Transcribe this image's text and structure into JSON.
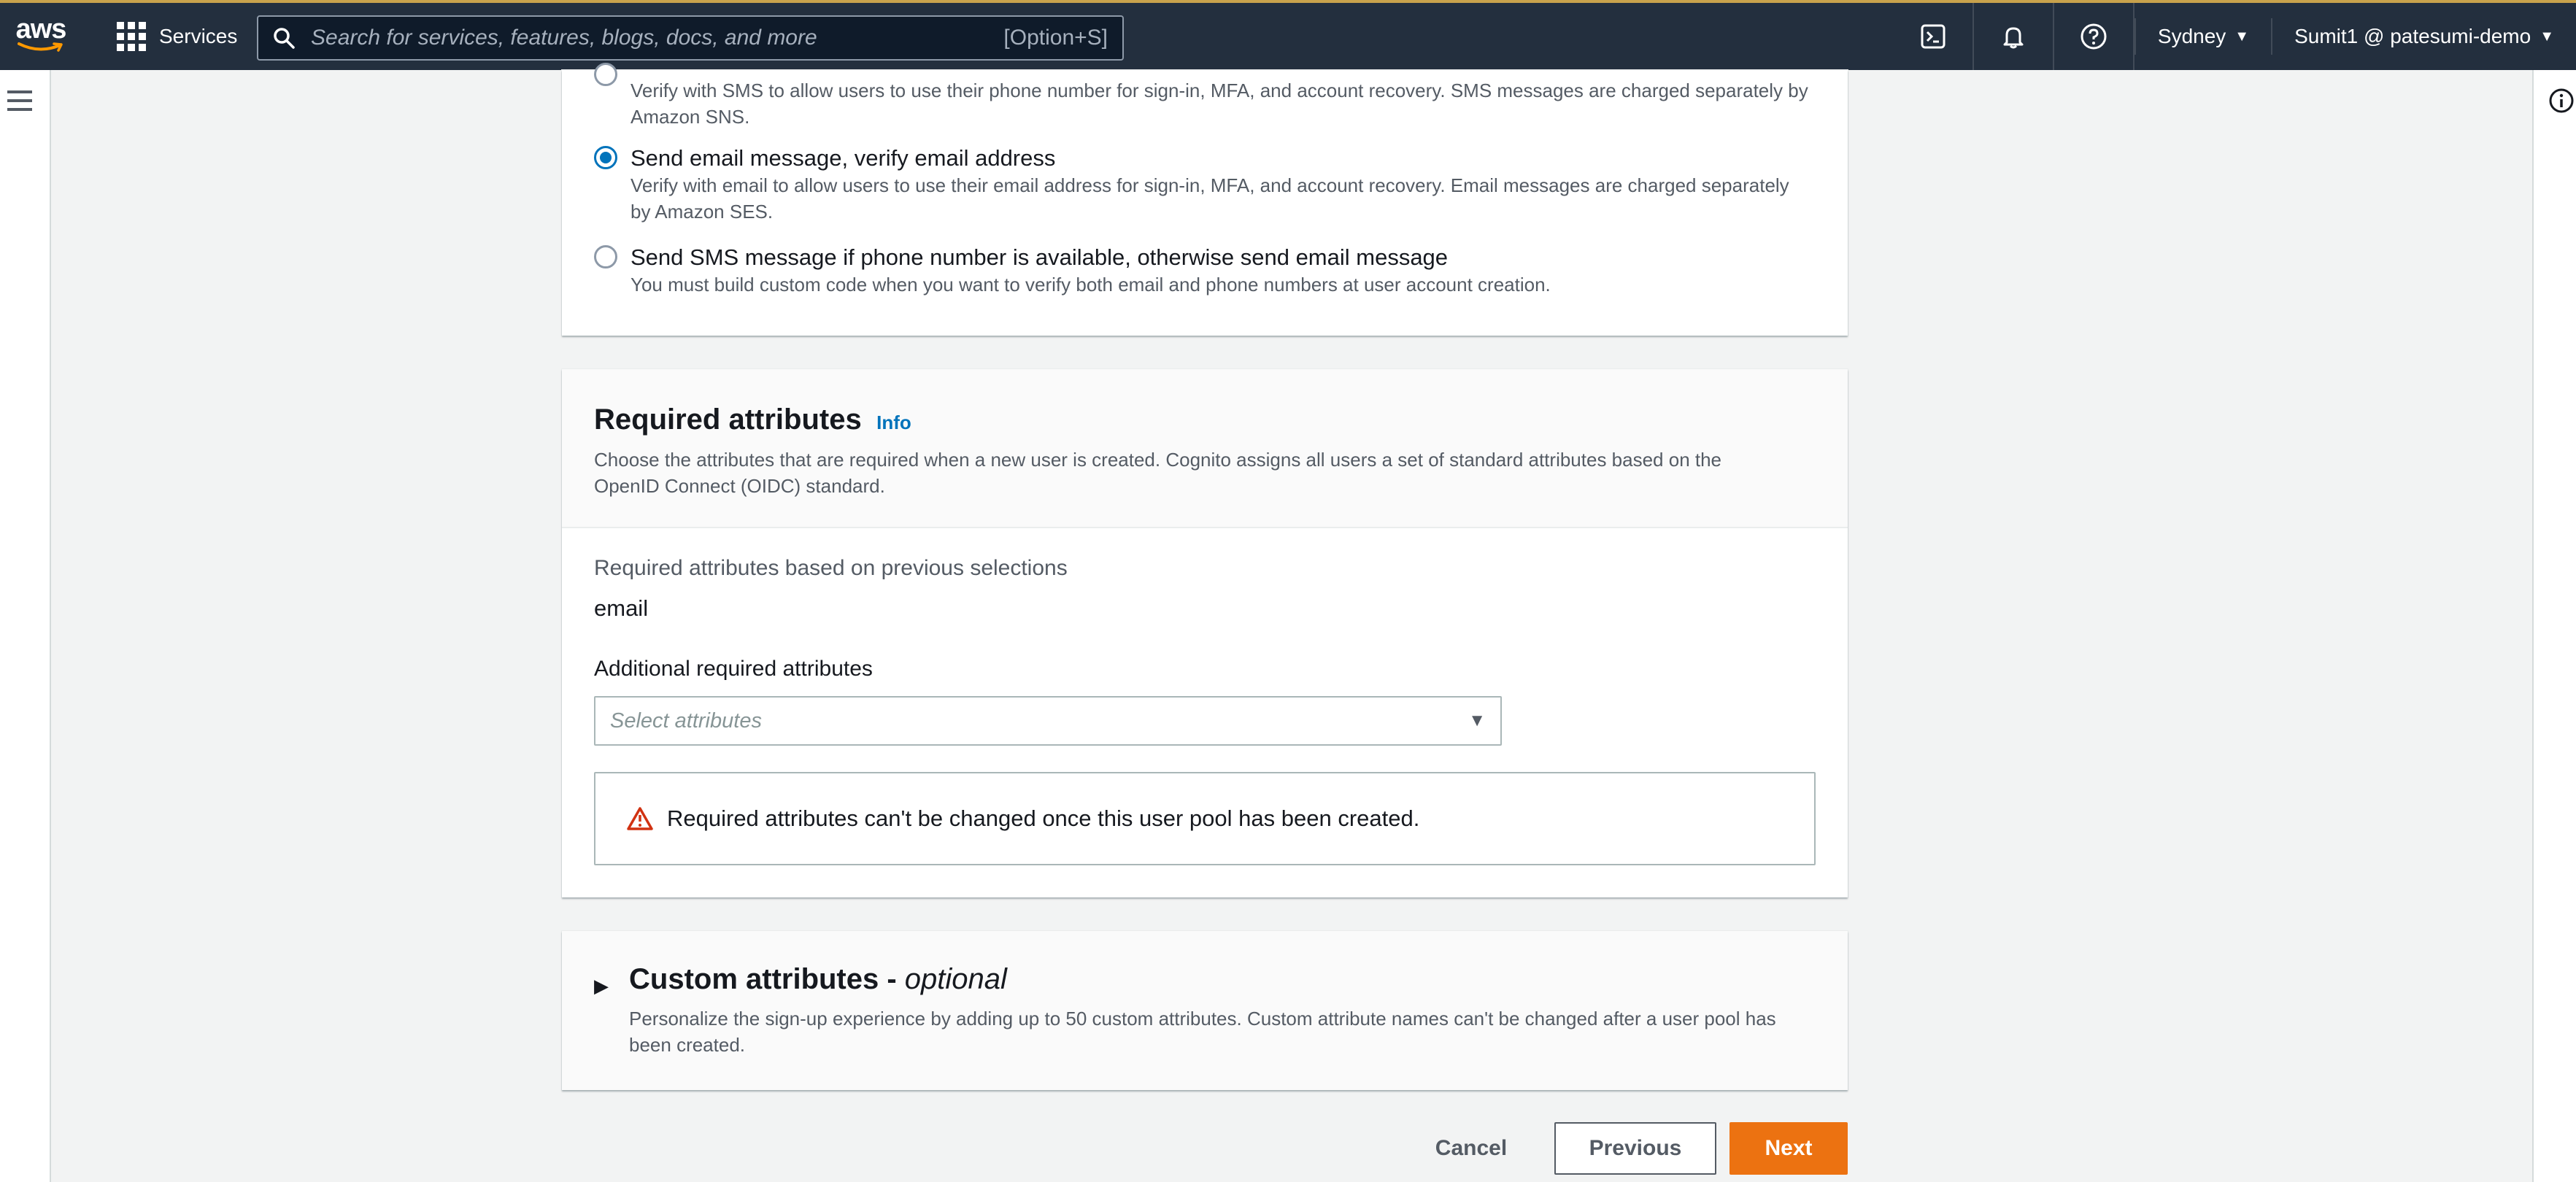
{
  "topnav": {
    "logo": "aws",
    "services_label": "Services",
    "search_placeholder": "Search for services, features, blogs, docs, and more",
    "search_shortcut": "[Option+S]",
    "region": "Sydney",
    "account": "Sumit1 @ patesumi-demo",
    "icons": [
      "cloudshell-icon",
      "bell-icon",
      "help-icon"
    ]
  },
  "verification": {
    "options": [
      {
        "label": "",
        "description": "Verify with SMS to allow users to use their phone number for sign-in, MFA, and account recovery. SMS messages are charged separately by Amazon SNS.",
        "selected": false
      },
      {
        "label": "Send email message, verify email address",
        "description": "Verify with email to allow users to use their email address for sign-in, MFA, and account recovery. Email messages are charged separately by Amazon SES.",
        "selected": true
      },
      {
        "label": "Send SMS message if phone number is available, otherwise send email message",
        "description": "You must build custom code when you want to verify both email and phone numbers at user account creation.",
        "selected": false
      }
    ]
  },
  "required_attributes": {
    "title": "Required attributes",
    "info": "Info",
    "description": "Choose the attributes that are required when a new user is created. Cognito assigns all users a set of standard attributes based on the OpenID Connect (OIDC) standard.",
    "based_on_label": "Required attributes based on previous selections",
    "based_on_value": "email",
    "additional_label": "Additional required attributes",
    "select_placeholder": "Select attributes",
    "warning": "Required attributes can't be changed once this user pool has been created."
  },
  "custom_attributes": {
    "title": "Custom attributes - ",
    "title_optional": "optional",
    "description": "Personalize the sign-up experience by adding up to 50 custom attributes. Custom attribute names can't be changed after a user pool has been created."
  },
  "footer": {
    "cancel": "Cancel",
    "previous": "Previous",
    "next": "Next"
  },
  "colors": {
    "nav_bg": "#232f3e",
    "accent_blue": "#0073bb",
    "primary_orange": "#ec7211",
    "warning_red": "#d13212"
  }
}
